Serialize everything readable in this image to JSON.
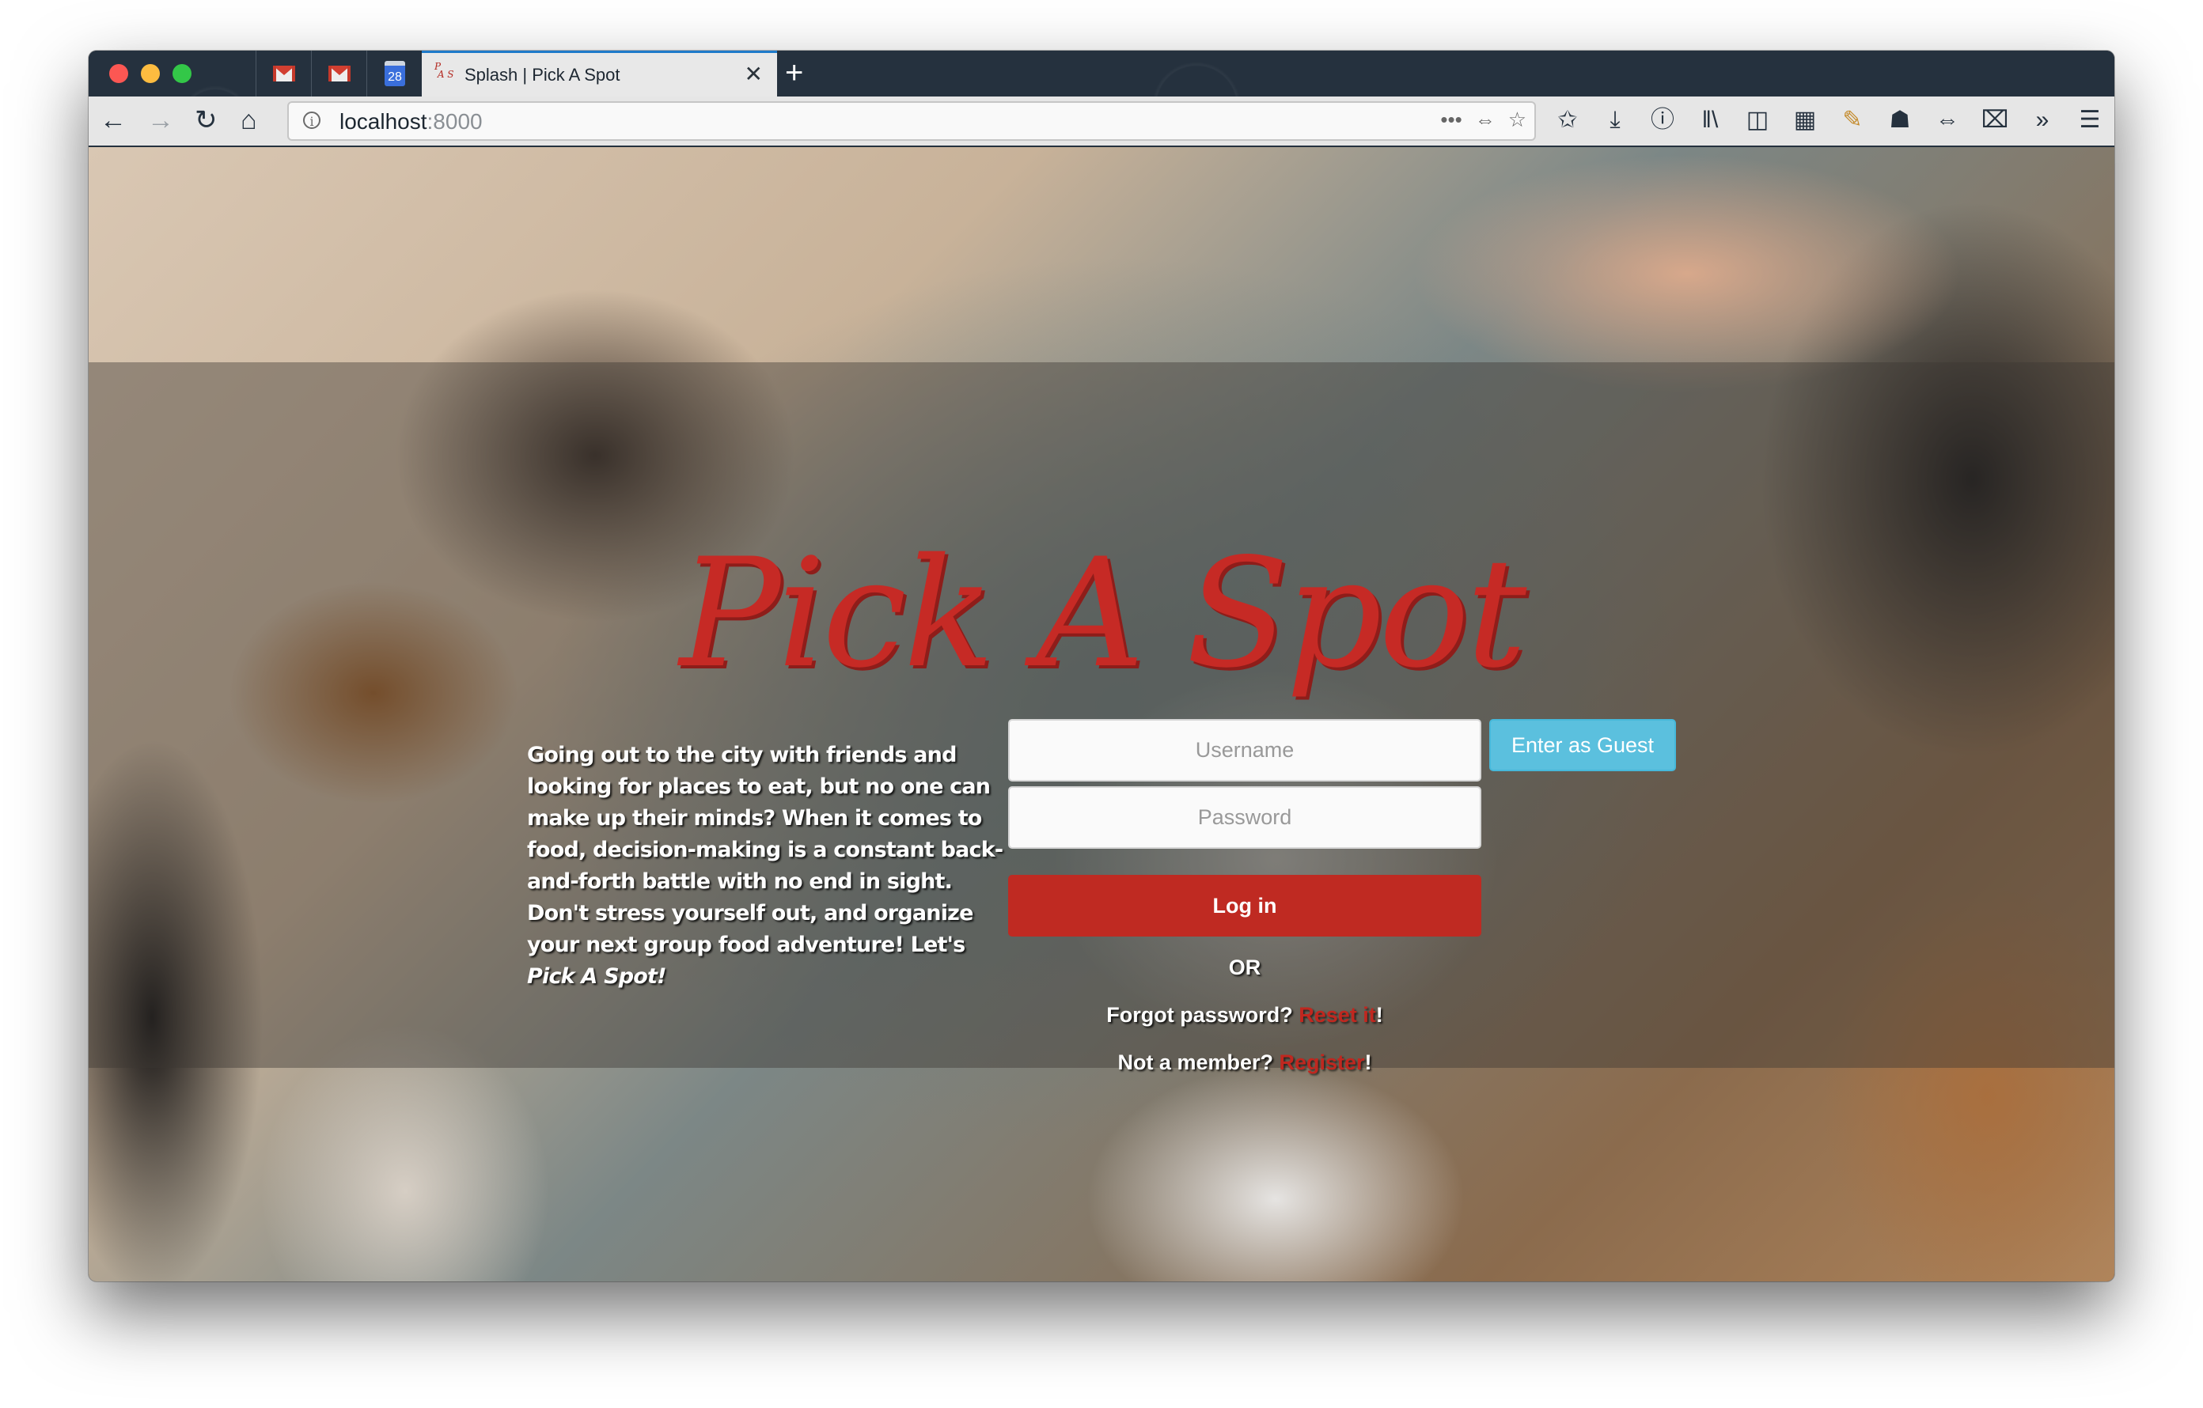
{
  "browser": {
    "pinned_tabs": [
      {
        "icon": "gmail-icon"
      },
      {
        "icon": "gmail-icon"
      },
      {
        "icon": "calendar-icon",
        "label": "28"
      }
    ],
    "active_tab": {
      "favicon_text": "PAS",
      "title": "Splash | Pick A Spot",
      "close_glyph": "✕"
    },
    "new_tab_glyph": "+",
    "nav": {
      "back": "←",
      "forward": "→",
      "reload": "↻",
      "home": "⌂"
    },
    "url": {
      "host": "localhost",
      "port": ":8000",
      "info_glyph": "i",
      "page_actions_glyph": "•••",
      "reader_glyph": "⇔",
      "bookmark_glyph": "☆"
    },
    "toolbar_icons": [
      {
        "name": "bookmarks-star-icon",
        "glyph": "✩"
      },
      {
        "name": "download-icon",
        "glyph": "⤓"
      },
      {
        "name": "password-manager-icon",
        "glyph": "ⓘ"
      },
      {
        "name": "library-icon",
        "glyph": "‖\\"
      },
      {
        "name": "sidebar-icon",
        "glyph": "◫"
      },
      {
        "name": "extensions-grid-icon",
        "glyph": "▦"
      },
      {
        "name": "inspect-pencil-icon",
        "glyph": "✎"
      },
      {
        "name": "incognito-icon",
        "glyph": "☗"
      },
      {
        "name": "responsive-icon",
        "glyph": "⇔"
      },
      {
        "name": "screenshot-icon",
        "glyph": "⌧"
      },
      {
        "name": "overflow-chevron-icon",
        "glyph": "»"
      },
      {
        "name": "hamburger-menu-icon",
        "glyph": "☰"
      }
    ]
  },
  "page": {
    "logo": "Pick A Spot",
    "intro_text": "Going out to the city with friends and looking for places to eat, but no one can make up their minds? When it comes to food, decision-making is a constant back-and-forth battle with no end in sight. Don't stress yourself out, and organize your next group food adventure! Let's ",
    "intro_emphasis": "Pick A Spot!",
    "username": {
      "placeholder": "Username",
      "value": ""
    },
    "password": {
      "placeholder": "Password",
      "value": ""
    },
    "guest_button": "Enter as Guest",
    "login_button": "Log in",
    "or_text": "OR",
    "forgot_prefix": "Forgot password? ",
    "forgot_link": "Reset it",
    "forgot_suffix": "!",
    "member_prefix": "Not a member? ",
    "member_link": "Register",
    "member_suffix": "!",
    "colors": {
      "brand_red": "#c62a25",
      "login_button": "#bf2a22",
      "guest_button": "#5bc0de"
    }
  }
}
